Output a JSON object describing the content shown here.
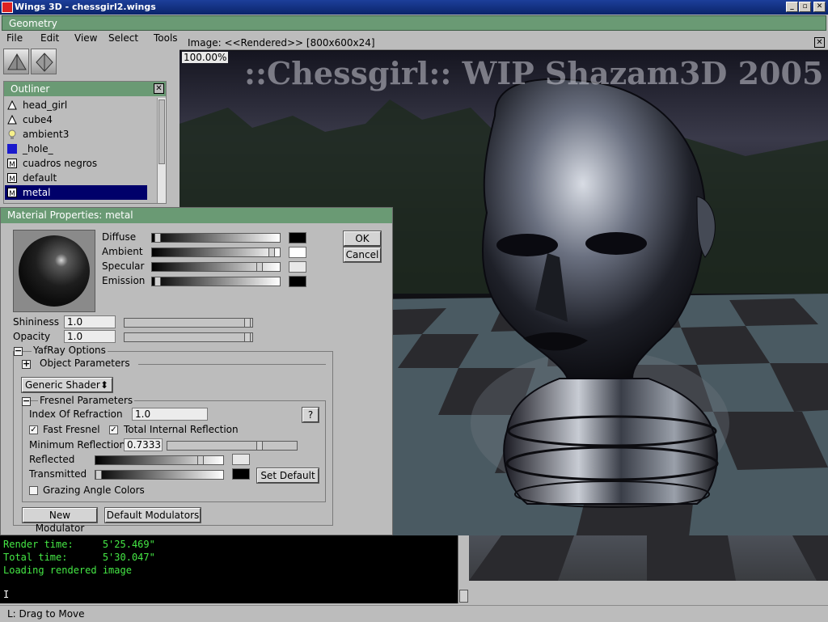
{
  "os": {
    "title": "Wings 3D - chessgirl2.wings"
  },
  "geometry": {
    "title": "Geometry"
  },
  "menu": {
    "file": "File",
    "edit": "Edit",
    "view": "View",
    "select": "Select",
    "tools": "Tools"
  },
  "outliner": {
    "title": "Outliner",
    "items": [
      {
        "label": "head_girl",
        "icon": "object-triangle-icon"
      },
      {
        "label": "cube4",
        "icon": "object-triangle-icon"
      },
      {
        "label": "ambient3",
        "icon": "light-bulb-icon"
      },
      {
        "label": "_hole_",
        "icon": "blue-square-icon"
      },
      {
        "label": "cuadros negros",
        "icon": "material-icon"
      },
      {
        "label": "default",
        "icon": "material-icon"
      },
      {
        "label": "metal",
        "icon": "material-icon",
        "selected": true
      }
    ]
  },
  "image": {
    "title": "Image: <<Rendered>> [800x600x24]",
    "zoom": "100.00%",
    "watermark": "::Chessgirl:: WIP Shazam3D 2005"
  },
  "material": {
    "title": "Material Properties: metal",
    "diffuse": "Diffuse",
    "ambient": "Ambient",
    "specular": "Specular",
    "emission": "Emission",
    "ok": "OK",
    "cancel": "Cancel",
    "shininess_label": "Shininess",
    "shininess": "1.0",
    "opacity_label": "Opacity",
    "opacity": "1.0",
    "yafray": "YafRay Options",
    "object_params": "Object Parameters",
    "shader": "Generic Shader",
    "fresnel": "Fresnel Parameters",
    "ior_label": "Index Of Refraction",
    "ior": "1.0",
    "help": "?",
    "fast_fresnel": "Fast Fresnel",
    "tir": "Total Internal Reflection",
    "min_refl_label": "Minimum Reflection",
    "min_refl": "0.7333",
    "reflected": "Reflected",
    "transmitted": "Transmitted",
    "set_default": "Set Default",
    "grazing": "Grazing Angle Colors",
    "new_mod": "New Modulator",
    "default_mods": "Default Modulators",
    "levels": {
      "diffuse": 0.02,
      "ambient": 0.97,
      "specular": 0.87,
      "emission": 0.02,
      "shininess": 1.0,
      "opacity": 1.0,
      "min_refl": 0.7333,
      "reflected": 0.85,
      "transmitted": 0.0
    },
    "colors": {
      "diffuse": "#000000",
      "ambient": "#ffffff",
      "specular": "#e8e8e8",
      "emission": "#000000",
      "reflected": "#e6e6e6",
      "transmitted": "#000000"
    }
  },
  "console": {
    "lines": [
      "Render time:     5'25.469\"",
      "Total time:      5'30.047\"",
      "Loading rendered image"
    ],
    "cursor": "I"
  },
  "status": {
    "text": "L: Drag to Move"
  },
  "colors": {
    "title_green": "#6a9a74",
    "console_text": "#45e845",
    "selected": "#00006a"
  }
}
